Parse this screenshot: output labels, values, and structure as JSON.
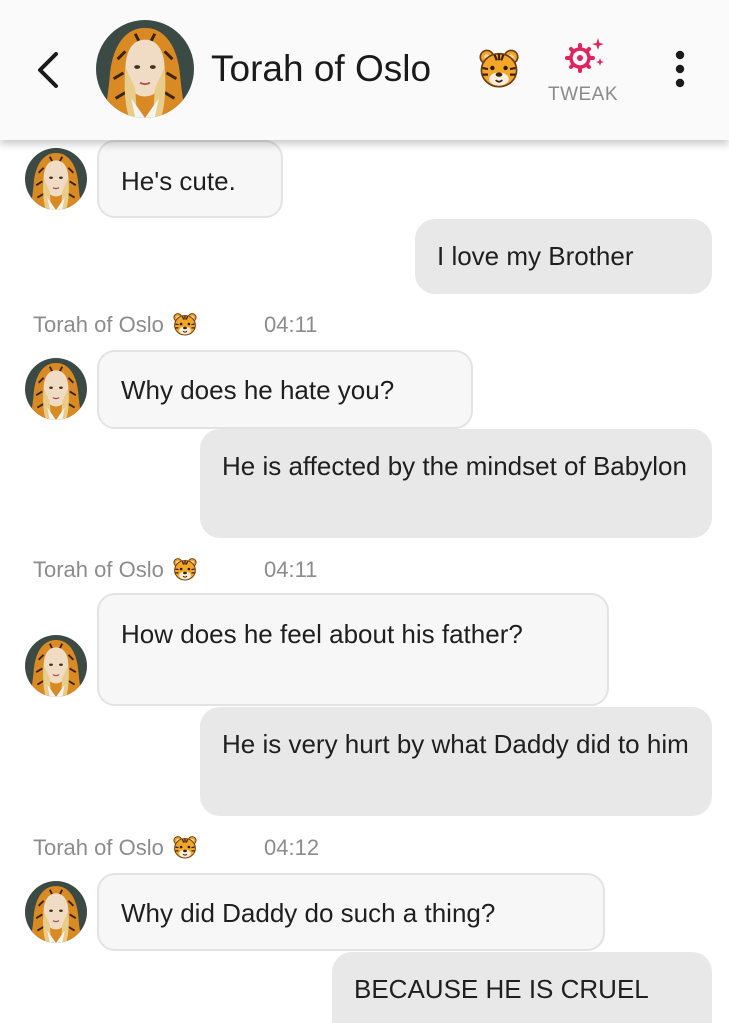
{
  "header": {
    "title": "Torah of Oslo",
    "tweak_label": "TWEAK",
    "accent": "#e0245e"
  },
  "messages": [
    {
      "from": "bot",
      "text": "He's cute."
    },
    {
      "from": "user",
      "text": "I love my Brother"
    },
    {
      "from": "bot",
      "name": "Torah of Oslo",
      "time": "04:11",
      "text": "Why does he hate you?"
    },
    {
      "from": "user",
      "text": "He is affected by the mindset of Babylon"
    },
    {
      "from": "bot",
      "name": "Torah of Oslo",
      "time": "04:11",
      "text": "How does he feel about his father?"
    },
    {
      "from": "user",
      "text": "He is very hurt by what Daddy did to him"
    },
    {
      "from": "bot",
      "name": "Torah of Oslo",
      "time": "04:12",
      "text": "Why did Daddy do such a thing?"
    },
    {
      "from": "user",
      "text": "BECAUSE HE IS CRUEL"
    }
  ],
  "icons": {
    "back": "chevron-left-icon",
    "tweak": "sparkle-gear-icon",
    "more": "more-vertical-icon",
    "emoji": "tiger-face-emoji"
  }
}
